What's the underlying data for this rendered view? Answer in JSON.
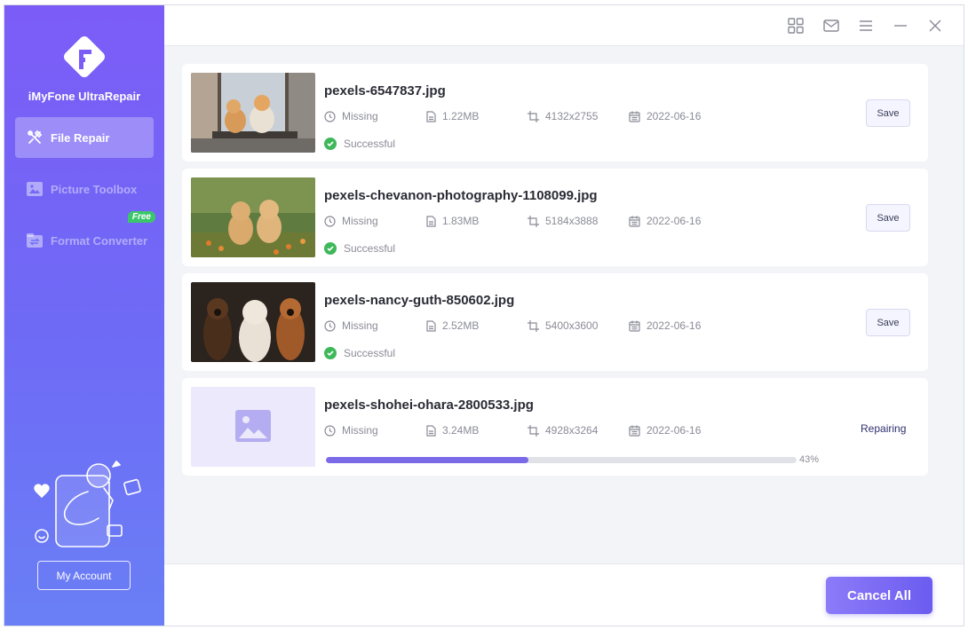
{
  "app": {
    "name": "iMyFone UltraRepair"
  },
  "sidebar": {
    "items": [
      {
        "label": "File Repair",
        "icon": "tools-icon",
        "active": true
      },
      {
        "label": "Picture Toolbox",
        "icon": "picture-icon",
        "active": false
      },
      {
        "label": "Format Converter",
        "icon": "converter-icon",
        "active": false,
        "badge": "Free"
      }
    ],
    "account_label": "My Account"
  },
  "titlebar": {
    "icons": [
      "grid-icon",
      "mail-icon",
      "menu-icon",
      "minimize-icon",
      "close-icon"
    ]
  },
  "files": [
    {
      "name": "pexels-6547837.jpg",
      "date_status": "Missing",
      "size": "1.22MB",
      "resolution": "4132x2755",
      "date": "2022-06-16",
      "status": "Successful",
      "action": "Save"
    },
    {
      "name": "pexels-chevanon-photography-1108099.jpg",
      "date_status": "Missing",
      "size": "1.83MB",
      "resolution": "5184x3888",
      "date": "2022-06-16",
      "status": "Successful",
      "action": "Save"
    },
    {
      "name": "pexels-nancy-guth-850602.jpg",
      "date_status": "Missing",
      "size": "2.52MB",
      "resolution": "5400x3600",
      "date": "2022-06-16",
      "status": "Successful",
      "action": "Save"
    },
    {
      "name": "pexels-shohei-ohara-2800533.jpg",
      "date_status": "Missing",
      "size": "3.24MB",
      "resolution": "4928x3264",
      "date": "2022-06-16",
      "status_label": "Repairing",
      "progress": 43,
      "progress_label": "43%"
    }
  ],
  "footer": {
    "cancel_label": "Cancel All"
  },
  "colors": {
    "accent": "#7b6ae8",
    "sidebar_top": "#7c5cf7",
    "sidebar_bottom": "#6a7ff5",
    "success": "#3eb85a"
  }
}
